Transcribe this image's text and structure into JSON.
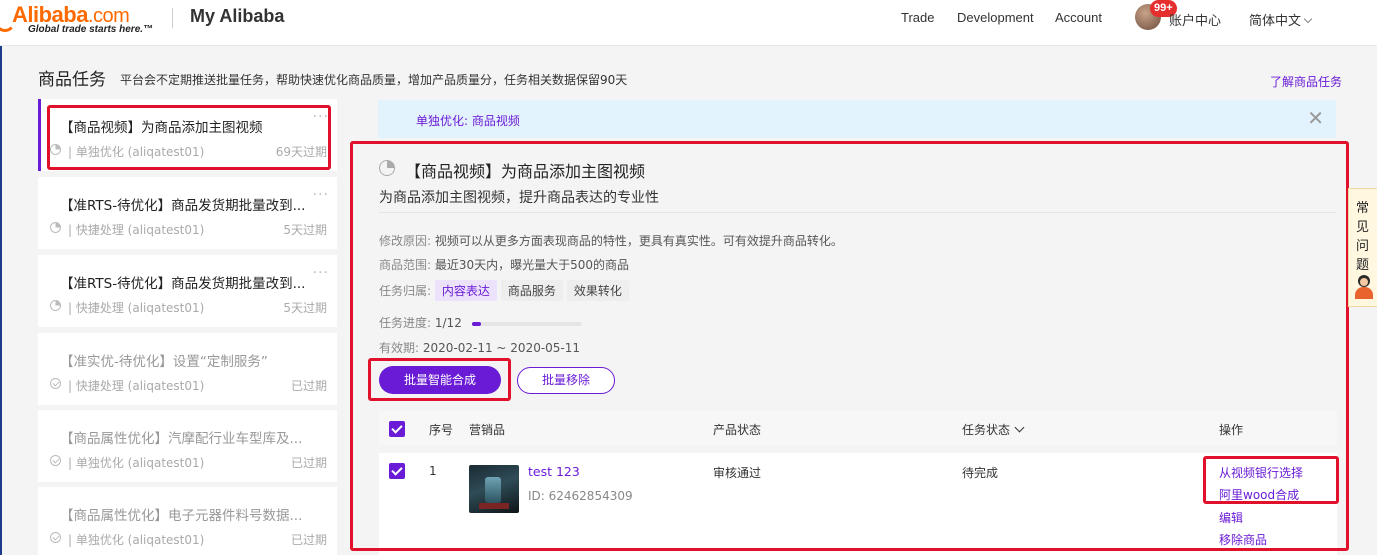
{
  "header": {
    "logo_text": "Alibaba",
    "logo_suffix": ".com",
    "logo_tagline": "Global trade starts here.™",
    "portal_title": "My Alibaba",
    "nav": [
      "Trade",
      "Development",
      "Account"
    ],
    "notification_badge": "99+",
    "account_center": "账户中心",
    "language": "简体中文"
  },
  "page": {
    "title": "商品任务",
    "description": "平台会不定期推送批量任务，帮助快速优化商品质量，增加产品质量分，任务相关数据保留90天",
    "learn_link": "了解商品任务"
  },
  "tasks": [
    {
      "title": "【商品视频】为商品添加主图视频",
      "meta": "| 单独优化 (aliqatest01)",
      "due": "69天过期",
      "icon": "pie-icon",
      "more": "···"
    },
    {
      "title": "【准RTS-待优化】商品发货期批量改到...",
      "meta": "| 快捷处理 (aliqatest01)",
      "due": "5天过期",
      "icon": "pie-icon",
      "more": "···"
    },
    {
      "title": "【准RTS-待优化】商品发货期批量改到...",
      "meta": "| 快捷处理 (aliqatest01)",
      "due": "5天过期",
      "icon": "pie-icon",
      "more": "···"
    },
    {
      "title": "【准实优-待优化】设置“定制服务”",
      "meta": "| 快捷处理 (aliqatest01)",
      "due": "已过期",
      "icon": "check-icon"
    },
    {
      "title": "【商品属性优化】汽摩配行业车型库及...",
      "meta": "| 单独优化 (aliqatest01)",
      "due": "已过期",
      "icon": "check-icon"
    },
    {
      "title": "【商品属性优化】电子元器件料号数据...",
      "meta": "| 单独优化 (aliqatest01)",
      "due": "已过期",
      "icon": "check-icon"
    }
  ],
  "info_bar": {
    "text": "单独优化: 商品视频",
    "close": "✕"
  },
  "detail": {
    "title": "【商品视频】为商品添加主图视频",
    "subtitle": "为商品添加主图视频，提升商品表达的专业性",
    "reason_label": "修改原因:",
    "reason": "视频可以从更多方面表现商品的特性，更具有真实性。可有效提升商品转化。",
    "scope_label": "商品范围:",
    "scope": "最近30天内，曝光量大于500的商品",
    "category_label": "任务归属:",
    "tags": [
      "内容表达",
      "商品服务",
      "效果转化"
    ],
    "progress_label": "任务进度:",
    "progress_text": "1/12",
    "progress_fraction": 0.083,
    "validity_label": "有效期:",
    "validity": "2020-02-11 ~ 2020-05-11",
    "btn_batch_compose": "批量智能合成",
    "btn_batch_remove": "批量移除"
  },
  "table": {
    "columns": [
      "序号",
      "营销品",
      "产品状态",
      "任务状态",
      "操作"
    ],
    "rows": [
      {
        "index": "1",
        "product_name": "test 123",
        "product_id": "ID: 62462854309",
        "status": "审核通过",
        "task_status": "待完成",
        "actions": [
          "从视频银行选择",
          "阿里wood合成",
          "编辑",
          "移除商品"
        ]
      }
    ]
  },
  "faq": {
    "label": "常见问题"
  },
  "colors": {
    "brand_orange": "#ff6a00",
    "accent_purple": "#6a1bd6",
    "highlight_red": "#e0112b",
    "info_bg": "#e3f3fd"
  }
}
